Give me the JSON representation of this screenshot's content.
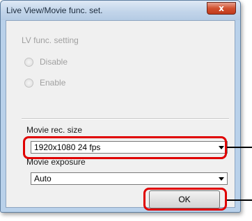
{
  "window": {
    "title": "Live View/Movie func. set.",
    "close_glyph": "x"
  },
  "lv_section": {
    "label": "LV func. setting",
    "options": [
      {
        "label": "Disable"
      },
      {
        "label": "Enable"
      }
    ]
  },
  "movie_rec_size": {
    "label": "Movie rec. size",
    "value": "1920x1080  24 fps"
  },
  "movie_exposure": {
    "label": "Movie exposure",
    "value": "Auto"
  },
  "buttons": {
    "ok_label": "OK"
  },
  "colors": {
    "highlight": "#e00000",
    "window_frame": "#b9d1ea",
    "dialog_background": "#f0f0f0"
  }
}
